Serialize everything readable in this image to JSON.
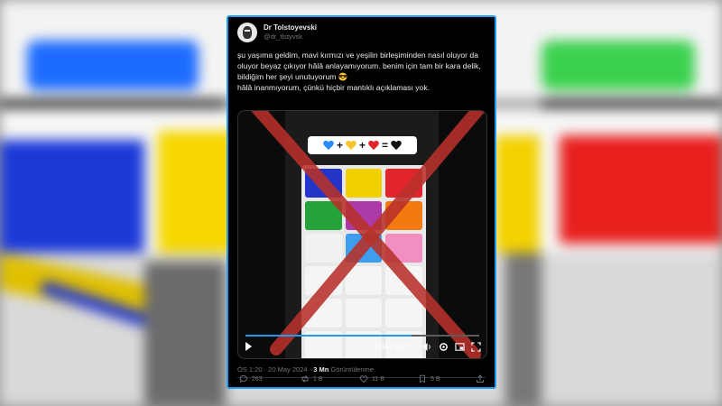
{
  "tweet": {
    "display_name": "Dr Tolstoyevski",
    "handle": "@dr_tlstyvsk",
    "text_lines": [
      "şu yaşıma geldim, mavi kırmızı ve yeşilin birleşiminden nasıl oluyor da",
      "oluyor  beyaz çıkıyor hâlâ anlayamıyorum. benim için tam bir kara delik,",
      "bildiğim her şeyi unutuyorum 😎",
      "hâlâ inanmıyorum, çünkü hiçbir mantıklı açıklaması yok."
    ],
    "media": {
      "equation_symbols": [
        "+",
        "+",
        "="
      ],
      "heart_colors": [
        "#2a8bf2",
        "#f7c529",
        "#e3242b",
        "#111111"
      ],
      "time": "0:44 / 1:02",
      "progress": 0.71,
      "x_color": "#c0392b",
      "wells": [
        "#2433c8",
        "#f2d000",
        "#e2242b",
        "#23a33a",
        "#ac3aa8",
        "#f27a10",
        "#f1f1f1",
        "#3d9ef0",
        "#f08fc0",
        "#f5f5f5",
        "#f5f5f5",
        "#f5f5f5",
        "#f5f5f5",
        "#f5f5f5",
        "#f5f5f5",
        "#f5f5f5",
        "#f5f5f5",
        "#f5f5f5"
      ]
    },
    "meta": {
      "time_date": "ÖS 1:20 · 20 May 2024 · ",
      "views_count": "3 Mn",
      "views_label": " Görüntülenme"
    },
    "actions": {
      "replies": "263",
      "retweets": "1 B",
      "likes": "11 B",
      "bookmarks": "5 B"
    }
  },
  "colors": {
    "accent": "#1d9bf0",
    "card_bg": "#000000",
    "muted": "#71767b"
  }
}
